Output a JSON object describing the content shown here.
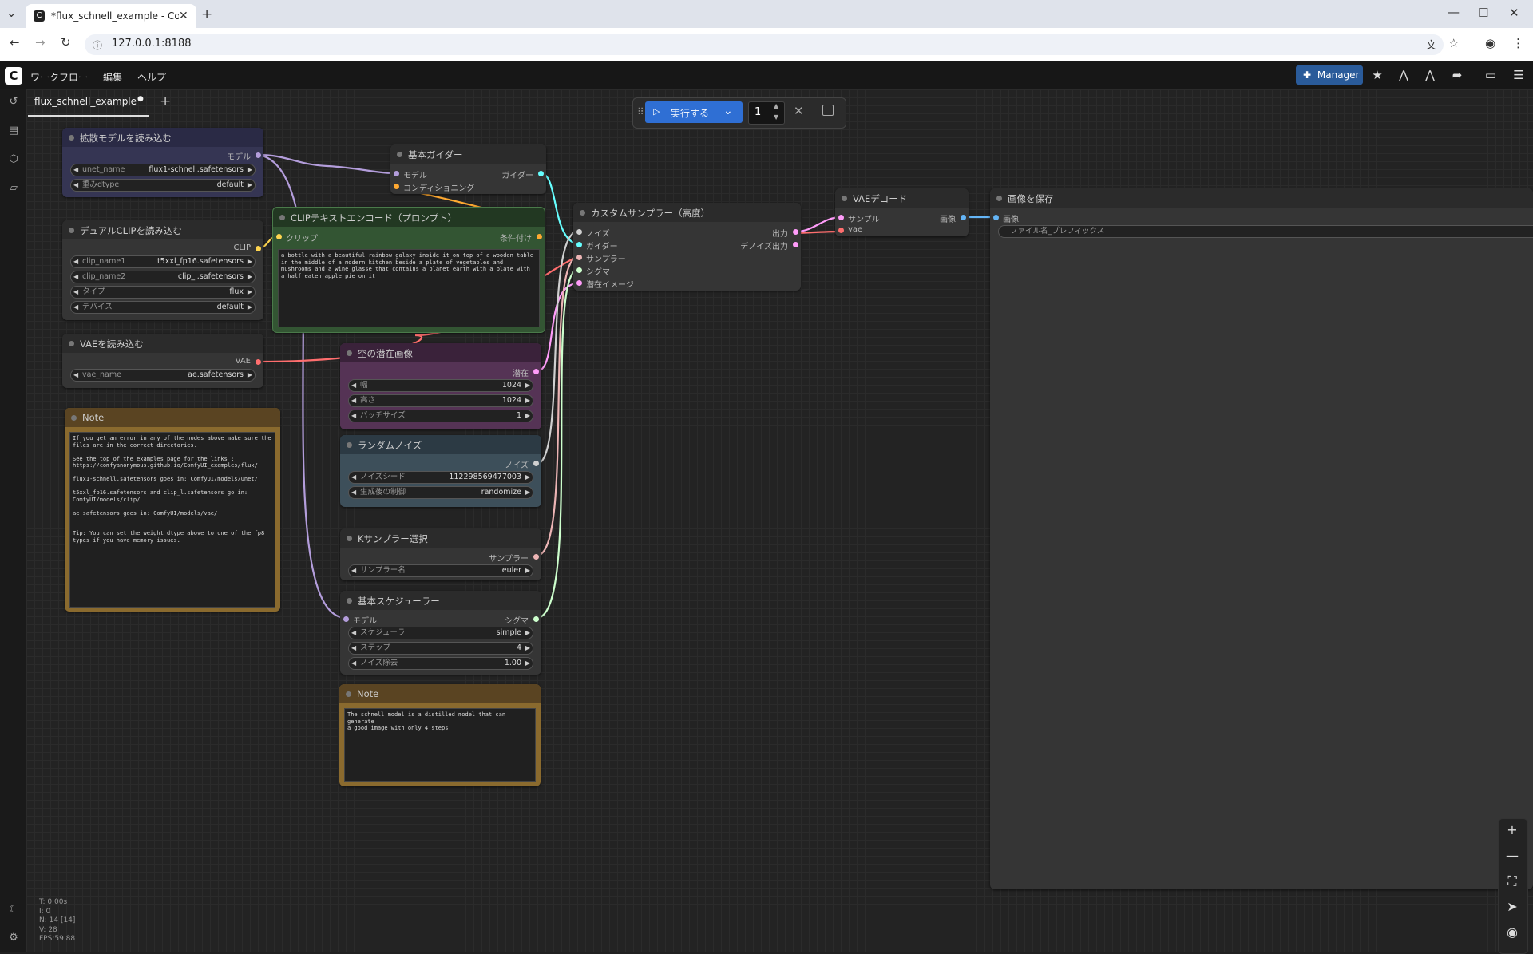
{
  "browser": {
    "tab_title": "*flux_schnell_example - ComfyUI",
    "url": "127.0.0.1:8188"
  },
  "menu": {
    "workflow": "ワークフロー",
    "edit": "編集",
    "help": "ヘルプ",
    "manager": "Manager"
  },
  "workflow_tab": {
    "label": "flux_schnell_example"
  },
  "run": {
    "label": "実行する",
    "count": "1"
  },
  "nodes": {
    "load_diffusion": {
      "title": "拡散モデルを読み込む",
      "out_model": "モデル",
      "w1_label": "unet_name",
      "w1_value": "flux1-schnell.safetensors",
      "w2_label": "重みdtype",
      "w2_value": "default"
    },
    "dual_clip": {
      "title": "デュアルCLIPを読み込む",
      "out_clip": "CLIP",
      "w1_label": "clip_name1",
      "w1_value": "t5xxl_fp16.safetensors",
      "w2_label": "clip_name2",
      "w2_value": "clip_l.safetensors",
      "w3_label": "タイプ",
      "w3_value": "flux",
      "w4_label": "デバイス",
      "w4_value": "default"
    },
    "vae_loader": {
      "title": "VAEを読み込む",
      "out_vae": "VAE",
      "w1_label": "vae_name",
      "w1_value": "ae.safetensors"
    },
    "note1": {
      "title": "Note",
      "text": "If you get an error in any of the nodes above make sure the\nfiles are in the correct directories.\n\nSee the top of the examples page for the links :\nhttps://comfyanonymous.github.io/ComfyUI_examples/flux/\n\nflux1-schnell.safetensors goes in: ComfyUI/models/unet/\n\nt5xxl_fp16.safetensors and clip_l.safetensors go in:\nComfyUI/models/clip/\n\nae.safetensors goes in: ComfyUI/models/vae/\n\n\nTip: You can set the weight_dtype above to one of the fp8\ntypes if you have memory issues."
    },
    "basic_guider": {
      "title": "基本ガイダー",
      "in_model": "モデル",
      "in_cond": "コンディショニング",
      "out_guider": "ガイダー"
    },
    "clip_text": {
      "title": "CLIPテキストエンコード（プロンプト）",
      "in_clip": "クリップ",
      "out_cond": "条件付け",
      "text": "a bottle with a beautiful rainbow galaxy inside it on top of a wooden table in the middle of a modern kitchen beside a plate of vegetables and mushrooms and a wine glasse that contains a planet earth with a plate with a half eaten apple pie on it"
    },
    "empty_latent": {
      "title": "空の潜在画像",
      "out_latent": "潜在",
      "w1_label": "幅",
      "w1_value": "1024",
      "w2_label": "高さ",
      "w2_value": "1024",
      "w3_label": "バッチサイズ",
      "w3_value": "1"
    },
    "random_noise": {
      "title": "ランダムノイズ",
      "out_noise": "ノイズ",
      "w1_label": "ノイズシード",
      "w1_value": "112298569477003",
      "w2_label": "生成後の制御",
      "w2_value": "randomize"
    },
    "ksampler_select": {
      "title": "Kサンプラー選択",
      "out_sampler": "サンプラー",
      "w1_label": "サンプラー名",
      "w1_value": "euler"
    },
    "basic_scheduler": {
      "title": "基本スケジューラー",
      "in_model": "モデル",
      "out_sigmas": "シグマ",
      "w1_label": "スケジューラ",
      "w1_value": "simple",
      "w2_label": "ステップ",
      "w2_value": "4",
      "w3_label": "ノイズ除去",
      "w3_value": "1.00"
    },
    "note2": {
      "title": "Note",
      "text": "The schnell model is a distilled model that can generate\na good image with only 4 steps."
    },
    "custom_sampler": {
      "title": "カスタムサンプラー（高度）",
      "in1": "ノイズ",
      "in2": "ガイダー",
      "in3": "サンプラー",
      "in4": "シグマ",
      "in5": "潜在イメージ",
      "out1": "出力",
      "out2": "デノイズ出力"
    },
    "vae_decode": {
      "title": "VAEデコード",
      "in_samples": "サンプル",
      "in_vae": "vae",
      "out_image": "画像"
    },
    "save_image": {
      "title": "画像を保存",
      "in_image": "画像",
      "w1_label": "ファイル名_プレフィックス"
    }
  },
  "stats": "T: 0.00s\nI: 0\nN: 14 [14]\nV: 28\nFPS:59.88",
  "colors": {
    "model_link": "#b39ddb",
    "clip_link": "#ffd54f",
    "vae_link": "#ff6e6e",
    "latent_link": "#ff9cf9",
    "cond_link": "#ffa931",
    "guider_link": "#66ffff",
    "sigmas_link": "#cdffcd",
    "sampler_link": "#ecb4b4",
    "image_link": "#64b5f6"
  }
}
